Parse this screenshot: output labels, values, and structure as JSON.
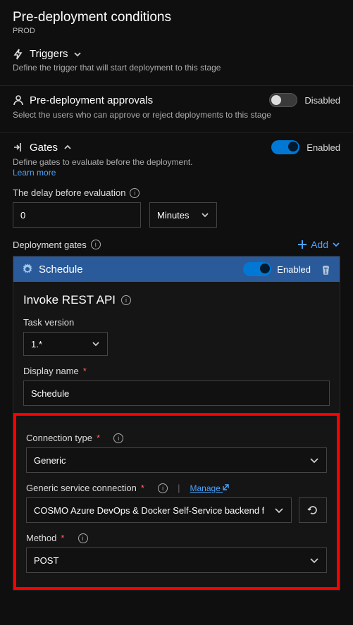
{
  "header": {
    "title": "Pre-deployment conditions",
    "env": "PROD"
  },
  "triggers": {
    "title": "Triggers",
    "desc": "Define the trigger that will start deployment to this stage"
  },
  "approvals": {
    "title": "Pre-deployment approvals",
    "state": "Disabled",
    "desc": "Select the users who can approve or reject deployments to this stage"
  },
  "gates": {
    "title": "Gates",
    "state": "Enabled",
    "desc": "Define gates to evaluate before the deployment.",
    "learn_more": "Learn more",
    "delay_label": "The delay before evaluation",
    "delay_value": "0",
    "delay_unit": "Minutes",
    "dg_label": "Deployment gates",
    "add_label": "Add"
  },
  "gate": {
    "name": "Schedule",
    "state": "Enabled",
    "api_title": "Invoke REST API",
    "task_version_label": "Task version",
    "task_version_value": "1.*",
    "display_name_label": "Display name",
    "display_name_value": "Schedule",
    "conn_type_label": "Connection type",
    "conn_type_value": "Generic",
    "gsc_label": "Generic service connection",
    "manage_label": "Manage",
    "gsc_value": "COSMO Azure DevOps & Docker Self-Service backend f",
    "method_label": "Method",
    "method_value": "POST"
  }
}
